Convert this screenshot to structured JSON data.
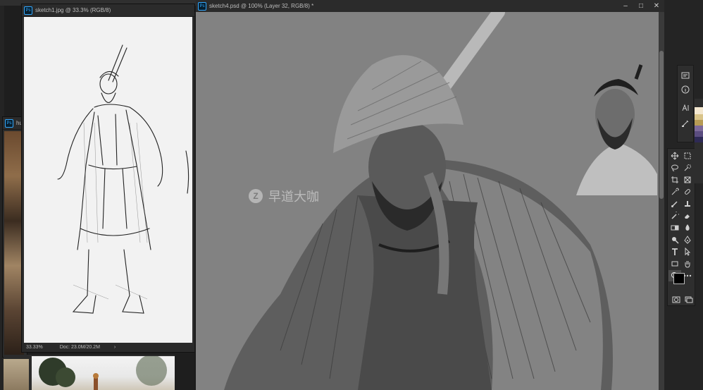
{
  "docs": {
    "back": {
      "title": "hum",
      "zoom": ""
    },
    "sketch1": {
      "title": "sketch1.jpg @ 33.3% (RGB/8)",
      "zoom": "33.33%",
      "doc_size": "Doc: 23.0M/20.2M"
    },
    "sketch4": {
      "title": "sketch4.psd @ 100% (Layer 32, RGB/8) *"
    }
  },
  "watermark": {
    "brand": "早道大咖"
  },
  "colors": {
    "accent": "#31a8ff",
    "canvas_gray": "#828282",
    "paper": "#f2f2f2"
  }
}
